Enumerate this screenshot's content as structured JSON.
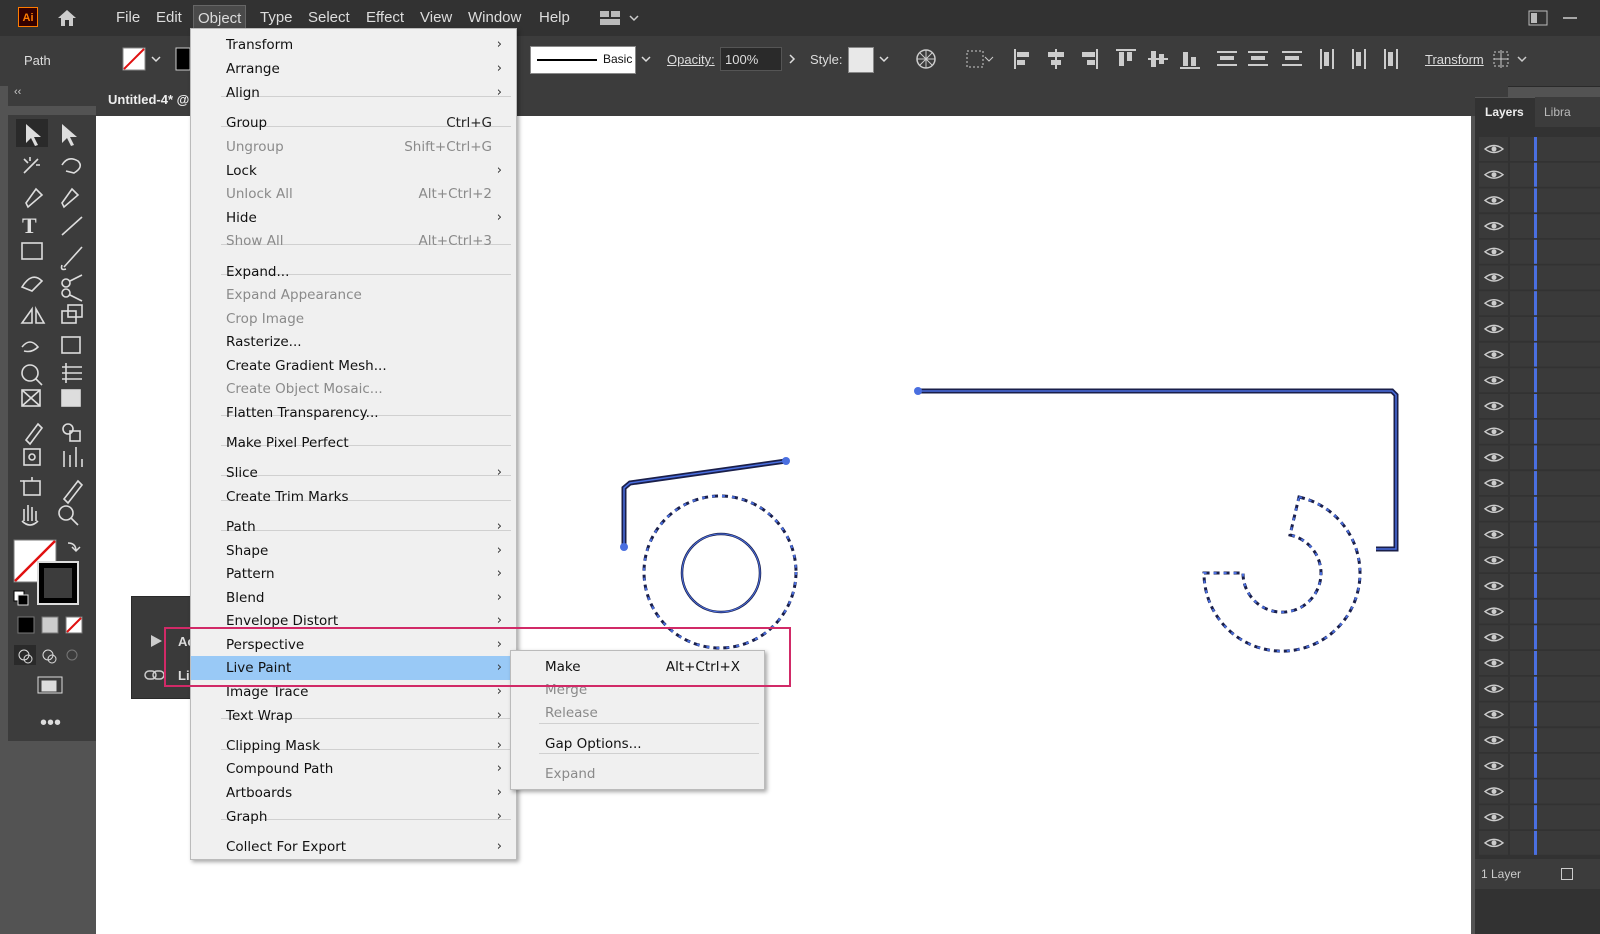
{
  "app": {
    "logo": "Ai"
  },
  "menubar": {
    "items": [
      "File",
      "Edit",
      "Object",
      "Type",
      "Select",
      "Effect",
      "View",
      "Window",
      "Help"
    ],
    "active": "Object"
  },
  "control_bar": {
    "selection_label": "Path",
    "stroke_style_label": "Basic",
    "opacity_label": "Opacity:",
    "opacity_value": "100%",
    "style_label": "Style:",
    "transform_label": "Transform"
  },
  "document": {
    "tab_title": "Untitled-4* @"
  },
  "panels": {
    "layers_tab": "Layers",
    "libraries_tab": "Libra",
    "layer_count": "1 Layer"
  },
  "mini_panel": {
    "item1": "Ac",
    "item2": "Li"
  },
  "object_menu": {
    "items": [
      {
        "label": "Transform",
        "shortcut": "",
        "submenu": true,
        "disabled": false
      },
      {
        "label": "Arrange",
        "shortcut": "",
        "submenu": true,
        "disabled": false
      },
      {
        "label": "Align",
        "shortcut": "",
        "submenu": true,
        "disabled": false
      },
      {
        "label": "Group",
        "shortcut": "Ctrl+G",
        "submenu": false,
        "disabled": false
      },
      {
        "label": "Ungroup",
        "shortcut": "Shift+Ctrl+G",
        "submenu": false,
        "disabled": true
      },
      {
        "label": "Lock",
        "shortcut": "",
        "submenu": true,
        "disabled": false
      },
      {
        "label": "Unlock All",
        "shortcut": "Alt+Ctrl+2",
        "submenu": false,
        "disabled": true
      },
      {
        "label": "Hide",
        "shortcut": "",
        "submenu": true,
        "disabled": false
      },
      {
        "label": "Show All",
        "shortcut": "Alt+Ctrl+3",
        "submenu": false,
        "disabled": true
      },
      {
        "label": "Expand...",
        "shortcut": "",
        "submenu": false,
        "disabled": false
      },
      {
        "label": "Expand Appearance",
        "shortcut": "",
        "submenu": false,
        "disabled": true
      },
      {
        "label": "Crop Image",
        "shortcut": "",
        "submenu": false,
        "disabled": true
      },
      {
        "label": "Rasterize...",
        "shortcut": "",
        "submenu": false,
        "disabled": false
      },
      {
        "label": "Create Gradient Mesh...",
        "shortcut": "",
        "submenu": false,
        "disabled": false
      },
      {
        "label": "Create Object Mosaic...",
        "shortcut": "",
        "submenu": false,
        "disabled": true
      },
      {
        "label": "Flatten Transparency...",
        "shortcut": "",
        "submenu": false,
        "disabled": false
      },
      {
        "label": "Make Pixel Perfect",
        "shortcut": "",
        "submenu": false,
        "disabled": false
      },
      {
        "label": "Slice",
        "shortcut": "",
        "submenu": true,
        "disabled": false
      },
      {
        "label": "Create Trim Marks",
        "shortcut": "",
        "submenu": false,
        "disabled": false
      },
      {
        "label": "Path",
        "shortcut": "",
        "submenu": true,
        "disabled": false
      },
      {
        "label": "Shape",
        "shortcut": "",
        "submenu": true,
        "disabled": false
      },
      {
        "label": "Pattern",
        "shortcut": "",
        "submenu": true,
        "disabled": false
      },
      {
        "label": "Blend",
        "shortcut": "",
        "submenu": true,
        "disabled": false
      },
      {
        "label": "Envelope Distort",
        "shortcut": "",
        "submenu": true,
        "disabled": false
      },
      {
        "label": "Perspective",
        "shortcut": "",
        "submenu": true,
        "disabled": false
      },
      {
        "label": "Live Paint",
        "shortcut": "",
        "submenu": true,
        "disabled": false,
        "highlighted": true
      },
      {
        "label": "Image Trace",
        "shortcut": "",
        "submenu": true,
        "disabled": false
      },
      {
        "label": "Text Wrap",
        "shortcut": "",
        "submenu": true,
        "disabled": false
      },
      {
        "label": "Clipping Mask",
        "shortcut": "",
        "submenu": true,
        "disabled": false
      },
      {
        "label": "Compound Path",
        "shortcut": "",
        "submenu": true,
        "disabled": false
      },
      {
        "label": "Artboards",
        "shortcut": "",
        "submenu": true,
        "disabled": false
      },
      {
        "label": "Graph",
        "shortcut": "",
        "submenu": true,
        "disabled": false
      },
      {
        "label": "Collect For Export",
        "shortcut": "",
        "submenu": true,
        "disabled": false
      }
    ]
  },
  "live_paint_submenu": {
    "items": [
      {
        "label": "Make",
        "shortcut": "Alt+Ctrl+X",
        "disabled": false
      },
      {
        "label": "Merge",
        "shortcut": "",
        "disabled": true
      },
      {
        "label": "Release",
        "shortcut": "",
        "disabled": true
      },
      {
        "label": "Gap Options...",
        "shortcut": "",
        "disabled": false
      },
      {
        "label": "Expand",
        "shortcut": "",
        "disabled": true
      }
    ]
  },
  "colors": {
    "highlight": "#99c9f6",
    "annotation_box": "#d12a67",
    "path_selection": "#4a6fe0",
    "path_stroke": "#1a1f4a"
  }
}
